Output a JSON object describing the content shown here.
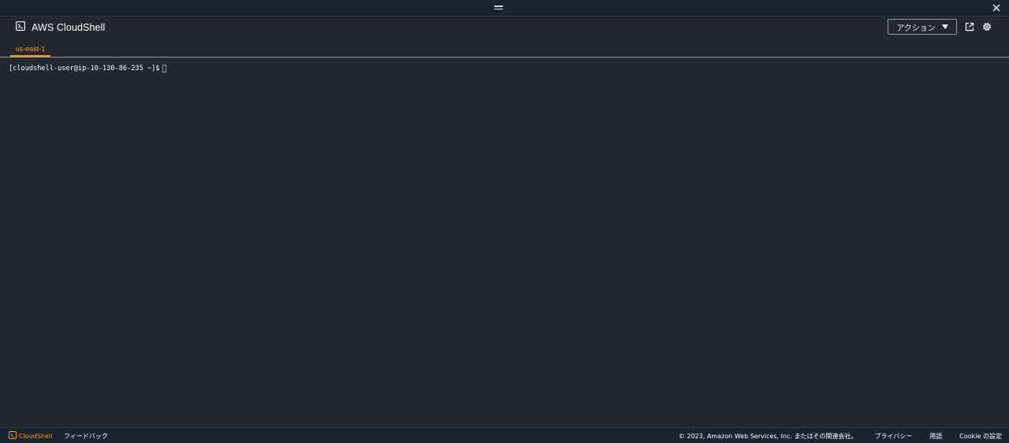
{
  "window": {
    "close_icon": "close-icon",
    "resize_icon": "drag-handle-icon"
  },
  "header": {
    "title": "AWS CloudShell",
    "title_icon": "terminal-icon",
    "actions_label": "アクション",
    "open_new_tab_icon": "external-link-icon",
    "settings_icon": "gear-icon"
  },
  "tabs": [
    {
      "label": "us-east-1",
      "active": true
    }
  ],
  "terminal": {
    "prompt": "[cloudshell-user@ip-10-130-86-235 ~]$"
  },
  "footer": {
    "brand_label": "CloudShell",
    "feedback_label": "フィードバック",
    "copyright": "© 2023, Amazon Web Services, Inc. またはその関連会社。",
    "privacy": "プライバシー",
    "terms": "用語",
    "cookies": "Cookie の設定"
  },
  "colors": {
    "background": "#232730",
    "bar": "#1b2331",
    "accent": "#ff9900",
    "border": "#8d99a8"
  }
}
